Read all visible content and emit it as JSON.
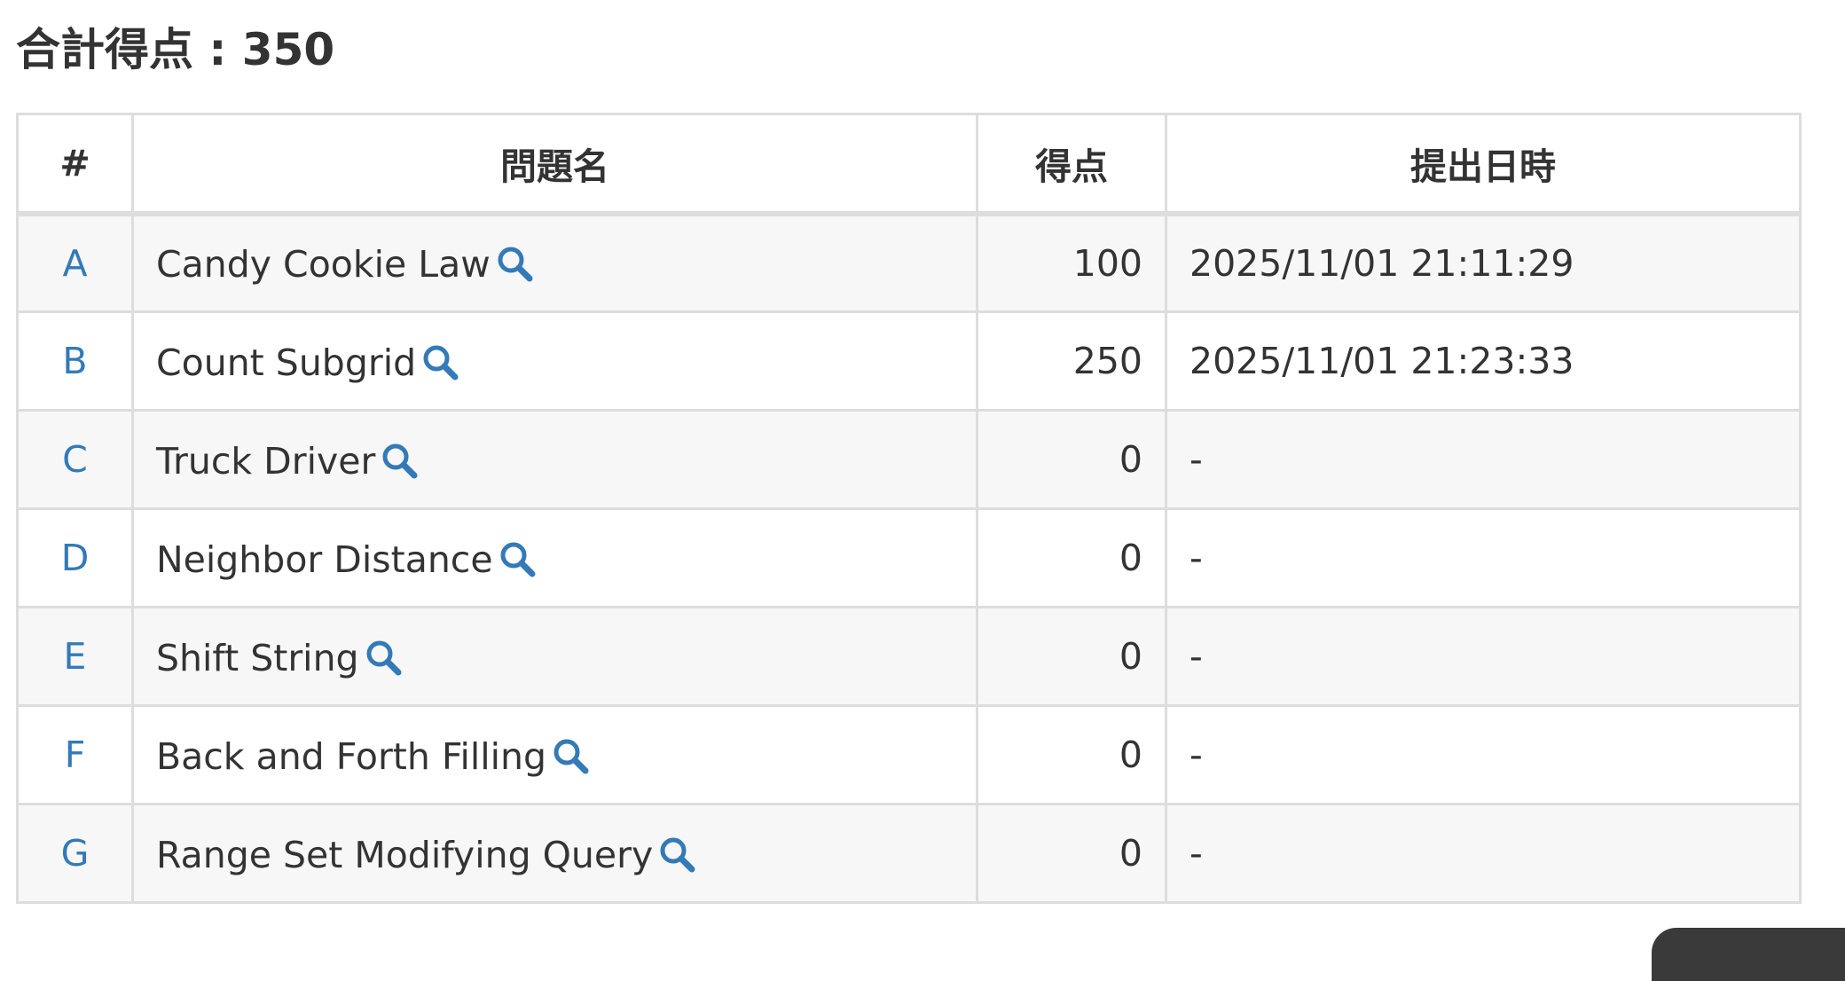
{
  "heading": {
    "total_label": "合計得点 : 350"
  },
  "table": {
    "headers": {
      "id": "#",
      "name": "問題名",
      "score": "得点",
      "time": "提出日時"
    },
    "rows": [
      {
        "id": "A",
        "name": "Candy Cookie Law",
        "score": "100",
        "time": "2025/11/01 21:11:29"
      },
      {
        "id": "B",
        "name": "Count Subgrid",
        "score": "250",
        "time": "2025/11/01 21:23:33"
      },
      {
        "id": "C",
        "name": "Truck Driver",
        "score": "0",
        "time": "-"
      },
      {
        "id": "D",
        "name": "Neighbor Distance",
        "score": "0",
        "time": "-"
      },
      {
        "id": "E",
        "name": "Shift String",
        "score": "0",
        "time": "-"
      },
      {
        "id": "F",
        "name": "Back and Forth Filling",
        "score": "0",
        "time": "-"
      },
      {
        "id": "G",
        "name": "Range Set Modifying Query",
        "score": "0",
        "time": "-"
      }
    ]
  },
  "icons": {
    "detail": "search-icon"
  },
  "colors": {
    "link": "#337ab7",
    "border": "#dddddd",
    "stripe": "#f7f7f7",
    "text": "#333333"
  }
}
